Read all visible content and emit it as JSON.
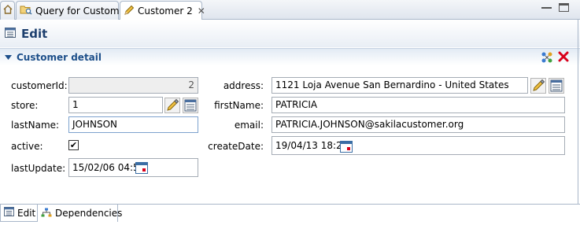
{
  "tabs": [
    {
      "label": "",
      "icon": "home-icon"
    },
    {
      "label": "Query for Customer",
      "icon": "query-folder-icon"
    },
    {
      "label": "Customer 2",
      "icon": "pencil-icon",
      "active": true
    }
  ],
  "edit": {
    "title": "Edit",
    "icon": "form-icon"
  },
  "section": {
    "title": "Customer detail"
  },
  "form": {
    "customerId": {
      "label": "customerId:",
      "value": "2"
    },
    "store": {
      "label": "store:",
      "value": "1"
    },
    "lastName": {
      "label": "lastName:",
      "value": "JOHNSON"
    },
    "active": {
      "label": "active:",
      "checked": true
    },
    "lastUpdate": {
      "label": "lastUpdate:",
      "value": "15/02/06 04:57"
    },
    "address": {
      "label": "address:",
      "value": "1121 Loja Avenue San Bernardino - United States"
    },
    "firstName": {
      "label": "firstName:",
      "value": "PATRICIA"
    },
    "email": {
      "label": "email:",
      "value": "PATRICIA.JOHNSON@sakilacustomer.org"
    },
    "createDate": {
      "label": "createDate:",
      "value": "19/04/13 18:22"
    }
  },
  "bottom_tabs": [
    {
      "label": "Edit",
      "icon": "form-icon",
      "active": true
    },
    {
      "label": "Dependencies",
      "icon": "hierarchy-icon"
    }
  ],
  "colors": {
    "accent": "#1d4f8a",
    "delete": "#d9001b"
  }
}
